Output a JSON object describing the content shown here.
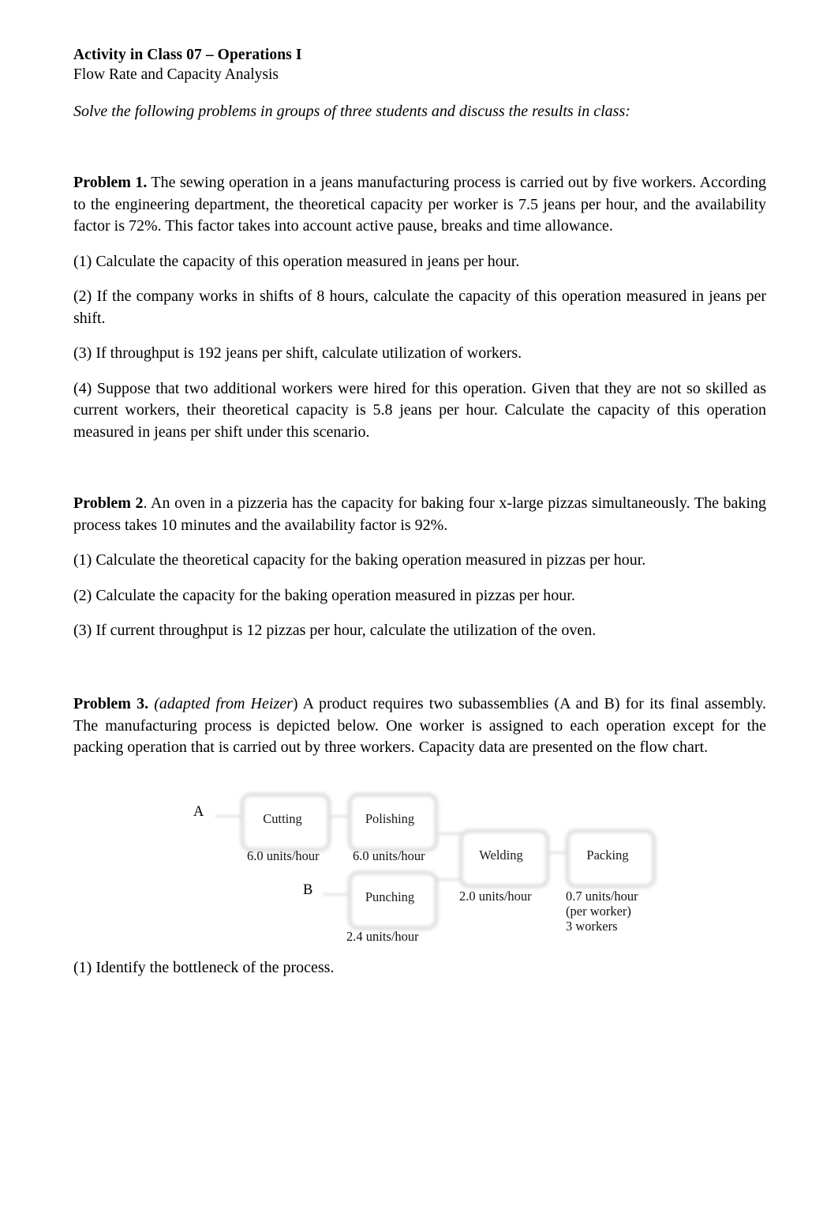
{
  "header": {
    "title": "Activity in Class 07 – Operations I",
    "subtitle": "Flow Rate and Capacity Analysis"
  },
  "instruction": "Solve the following problems in groups of three students and discuss the results in class:",
  "problem1": {
    "lead": "Problem 1.",
    "body": " The sewing operation in a jeans manufacturing process is carried out by five workers. According to the engineering department, the theoretical capacity per worker is 7.5 jeans per hour, and the availability factor is 72%. This factor takes into account active pause, breaks and time allowance.",
    "q1": "(1) Calculate the capacity of this operation measured in jeans per hour.",
    "q2": "(2) If the company works in shifts of 8 hours, calculate the capacity of this operation measured in jeans per shift.",
    "q3": "(3) If throughput is 192 jeans per shift, calculate utilization of workers.",
    "q4": "(4) Suppose that two additional workers were hired for this operation. Given that they are not so skilled as current workers, their theoretical capacity is 5.8 jeans per hour. Calculate the capacity of this operation measured in jeans per shift under this scenario."
  },
  "problem2": {
    "lead": "Problem 2",
    "body": ". An oven in a pizzeria has the capacity for baking four x-large pizzas simultaneously. The baking process takes 10 minutes and the availability factor is 92%.",
    "q1": "(1) Calculate the theoretical capacity for the baking operation measured in pizzas per hour.",
    "q2": "(2) Calculate the capacity for the baking operation measured in pizzas per hour.",
    "q3": "(3) If current throughput is 12 pizzas per hour, calculate the utilization of the oven."
  },
  "problem3": {
    "lead": "Problem 3.",
    "lead_italic": " (adapted from Heizer",
    "body": ") A product requires two subassemblies (A and B) for its final assembly. The manufacturing process is depicted below. One worker is assigned to each operation except for the packing operation that is carried out by three workers. Capacity data are presented on the flow chart.",
    "q1": "(1) Identify the bottleneck of the process."
  },
  "flowchart": {
    "endpoint_a": "A",
    "endpoint_b": "B",
    "nodes": [
      {
        "id": "cutting",
        "label": "Cutting",
        "capacity": "6.0 units/hour"
      },
      {
        "id": "polishing",
        "label": "Polishing",
        "capacity": "6.0 units/hour"
      },
      {
        "id": "punching",
        "label": "Punching",
        "capacity": "2.4 units/hour"
      },
      {
        "id": "welding",
        "label": "Welding",
        "capacity": "2.0 units/hour"
      },
      {
        "id": "packing",
        "label": "Packing",
        "capacity": "0.7 units/hour"
      }
    ],
    "packing_note_line1": "(per worker)",
    "packing_note_line2": "3 workers"
  },
  "chart_data": {
    "type": "diagram",
    "title": "Manufacturing process flow chart",
    "nodes": [
      {
        "name": "Cutting",
        "capacity_units_per_hour": 6.0,
        "workers": 1,
        "input": "A"
      },
      {
        "name": "Polishing",
        "capacity_units_per_hour": 6.0,
        "workers": 1
      },
      {
        "name": "Punching",
        "capacity_units_per_hour": 2.4,
        "workers": 1,
        "input": "B"
      },
      {
        "name": "Welding",
        "capacity_units_per_hour": 2.0,
        "workers": 1
      },
      {
        "name": "Packing",
        "capacity_units_per_hour": 0.7,
        "workers": 3
      }
    ],
    "edges": [
      {
        "from": "A",
        "to": "Cutting"
      },
      {
        "from": "Cutting",
        "to": "Polishing"
      },
      {
        "from": "B",
        "to": "Punching"
      },
      {
        "from": "Polishing",
        "to": "Welding"
      },
      {
        "from": "Punching",
        "to": "Welding"
      },
      {
        "from": "Welding",
        "to": "Packing"
      }
    ]
  }
}
